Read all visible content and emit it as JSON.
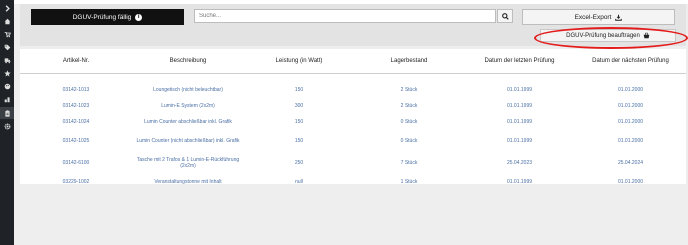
{
  "toolbar": {
    "due_button_label": "DGUV-Prüfung fällig",
    "search_placeholder": "Suche...",
    "excel_label": "Excel-Export",
    "order_label": "DGUV-Prüfung beauftragen"
  },
  "table": {
    "headers": [
      "Artikel-Nr.",
      "Beschreibung",
      "Leistung (in Watt)",
      "Lagerbestand",
      "Datum der letzten Prüfung",
      "Datum der nächsten Prüfung"
    ],
    "rows": [
      [
        "03142-1013",
        "Loungetisch (nicht beleuchtbar)",
        "150",
        "2 Stück",
        "01.01.1999",
        "01.01.2000"
      ],
      [
        "03142-1023",
        "Lumin-E System (2x2m)",
        "300",
        "2 Stück",
        "01.01.1999",
        "01.01.2000"
      ],
      [
        "03142-1024",
        "Lumin Counter abschließbar inkl. Grafik",
        "150",
        "0 Stück",
        "01.01.1999",
        "01.01.2000"
      ],
      [
        "03142-1025",
        "Lumin Counter (nicht abschließbar) inkl. Grafik",
        "150",
        "0 Stück",
        "01.01.1999",
        "01.01.2000"
      ],
      [
        "03142-6100",
        "Tasche mit 2 Trafos & 1 Lumin-E-Rückführung (2x2m)",
        "250",
        "7 Stück",
        "25.04.2023",
        "25.04.2024"
      ],
      [
        "03229-1002",
        "Veranstaltungstonne mit Inhalt",
        "null",
        "1 Stück",
        "01.01.1999",
        "01.01.2000"
      ]
    ]
  },
  "colors": {
    "sidebar": "#1f2328",
    "link": "#4a6fa5",
    "highlight_circle": "#e41b1b",
    "due_button": "#111111"
  },
  "sidebar_icons": [
    "chevron-right-icon",
    "home-icon",
    "cart-icon",
    "tag-icon",
    "truck-icon",
    "star-icon",
    "palette-icon",
    "chart-icon",
    "clipboard-icon",
    "gear-icon"
  ]
}
